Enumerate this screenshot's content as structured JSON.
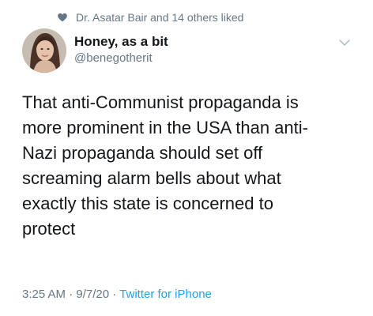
{
  "social_context": {
    "icon": "heart-icon",
    "text": "Dr. Asatar Bair and 14 others liked"
  },
  "author": {
    "display_name": "Honey, as a bit",
    "handle": "@benegotherit",
    "avatar_icon": "avatar"
  },
  "tweet": {
    "lines": [
      "That anti-Communist propaganda is",
      "more prominent in the USA than anti-",
      "Nazi propaganda should set off",
      "screaming alarm bells about what",
      "exactly this state is concerned to",
      "protect"
    ]
  },
  "meta": {
    "time": "3:25 AM",
    "separator": " · ",
    "date": "9/7/20",
    "source": "Twitter for iPhone"
  },
  "menu": {
    "icon": "chevron-down-icon"
  },
  "colors": {
    "secondary_text": "#657786",
    "link": "#1da1f2",
    "primary_text": "#14171a"
  }
}
